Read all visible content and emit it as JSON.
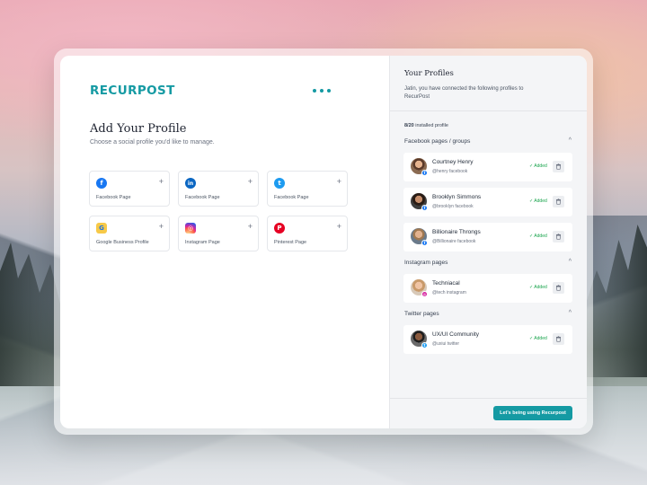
{
  "brand": {
    "logo": "RECURPOST",
    "accent": "#159aa3"
  },
  "left": {
    "title": "Add Your Profile",
    "subtitle": "Choose a social profile you'd like to manage.",
    "tiles": [
      {
        "icon": "facebook-icon",
        "glyph": "f",
        "label": "Facebook Page"
      },
      {
        "icon": "linkedin-icon",
        "glyph": "in",
        "label": "Facebook Page"
      },
      {
        "icon": "twitter-icon",
        "glyph": "t",
        "label": "Facebook Page"
      },
      {
        "icon": "google-business-icon",
        "glyph": "G",
        "label": "Google Business Profile"
      },
      {
        "icon": "instagram-icon",
        "glyph": "◎",
        "label": "Instagram Page"
      },
      {
        "icon": "pinterest-icon",
        "glyph": "P",
        "label": "Pinterest Page"
      }
    ],
    "plus": "+"
  },
  "right": {
    "title": "Your Profiles",
    "description": "Jatin, you have connected the following profiles to RecurPost",
    "count": "8/20",
    "count_suffix": " installed profile",
    "chevron": "^",
    "sections": {
      "facebook": {
        "title": "Facebook pages / groups",
        "items": [
          {
            "name": "Courtney Henry",
            "handle": "@henry facebook",
            "status": "✓ Added"
          },
          {
            "name": "Brooklyn Simmons",
            "handle": "@brooklyn facebook",
            "status": "✓ Added"
          },
          {
            "name": "Billionaire Throngs",
            "handle": "@Billionaire facebook",
            "status": "✓ Added"
          }
        ]
      },
      "instagram": {
        "title": "Instagram pages",
        "items": [
          {
            "name": "Techniacal",
            "handle": "@tech instagram",
            "status": "✓ Added"
          }
        ]
      },
      "twitter": {
        "title": "Twitter pages",
        "items": [
          {
            "name": "UX/UI Community",
            "handle": "@uxiui twitter",
            "status": "✓ Added"
          }
        ]
      }
    },
    "cta": "Let's being using Recurpost"
  }
}
